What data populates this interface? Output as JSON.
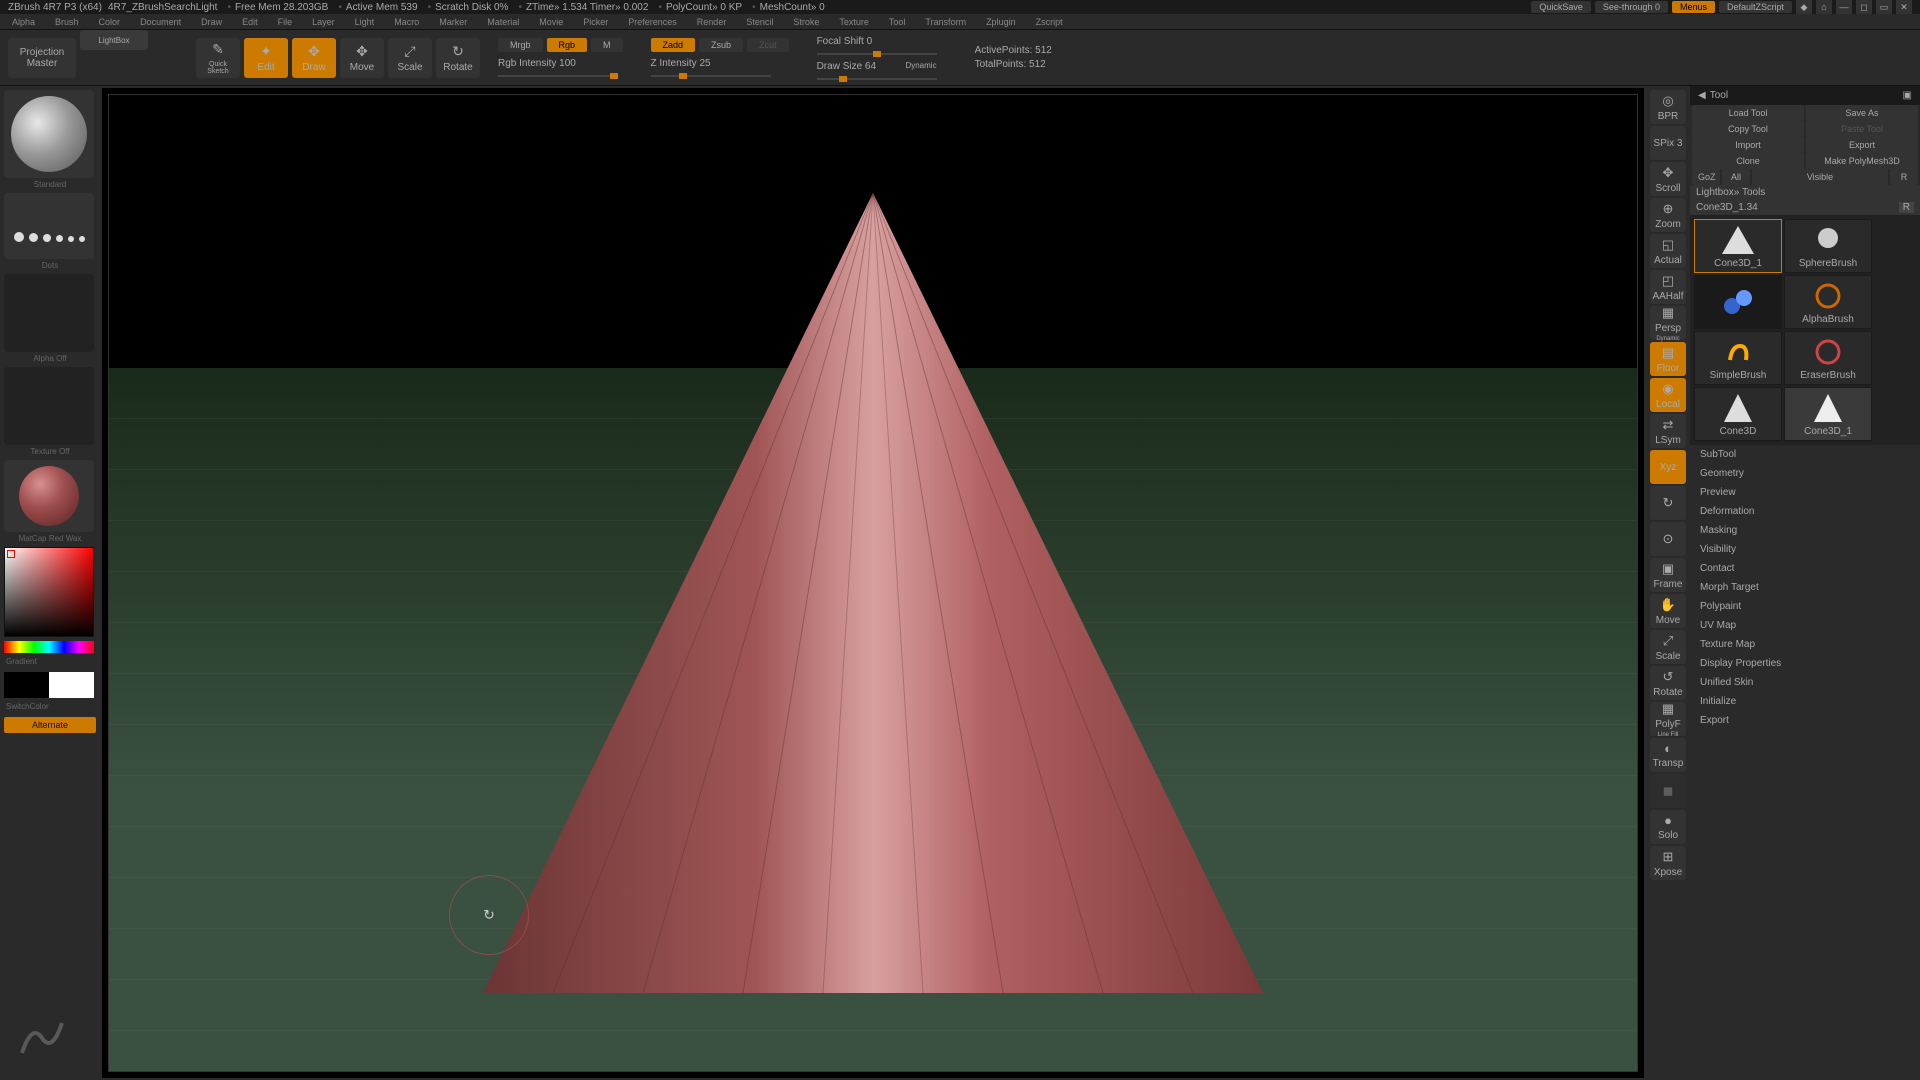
{
  "status": {
    "app": "ZBrush 4R7 P3 (x64)",
    "doc": "4R7_ZBrushSearchLight",
    "mem": "Free Mem 28.203GB",
    "active_mem": "Active Mem 539",
    "scratch": "Scratch Disk 0%",
    "ztime": "ZTime» 1.534 Timer» 0.002",
    "poly": "PolyCount» 0 KP",
    "mesh": "MeshCount» 0",
    "quicksave": "QuickSave",
    "seethrough": "See-through   0",
    "menus": "Menus",
    "script": "DefaultZScript"
  },
  "menus": [
    "Alpha",
    "Brush",
    "Color",
    "Document",
    "Draw",
    "Edit",
    "File",
    "Layer",
    "Light",
    "Macro",
    "Marker",
    "Material",
    "Movie",
    "Picker",
    "Preferences",
    "Render",
    "Stencil",
    "Stroke",
    "Texture",
    "Tool",
    "Transform",
    "Zplugin",
    "Zscript"
  ],
  "toolbar": {
    "projection": "Projection\nMaster",
    "lightbox": "LightBox",
    "quicksketch": "Quick\nSketch",
    "edit": "Edit",
    "draw": "Draw",
    "move": "Move",
    "scale": "Scale",
    "rotate": "Rotate",
    "mrgb": "Mrgb",
    "rgb": "Rgb",
    "m": "M",
    "rgb_intensity": "Rgb Intensity 100",
    "zadd": "Zadd",
    "zsub": "Zsub",
    "zcut": "Zcut",
    "z_intensity": "Z Intensity 25",
    "focal": "Focal Shift 0",
    "draw_size": "Draw Size 64",
    "dynamic": "Dynamic",
    "active_points": "ActivePoints: 512",
    "total_points": "TotalPoints: 512"
  },
  "left": {
    "brush": "Standard",
    "dots": "Dots",
    "alpha": "Alpha Off",
    "texture": "Texture Off",
    "matcap": "MatCap Red Wax",
    "gradient": "Gradient",
    "switchcolor": "SwitchColor",
    "alternate": "Alternate"
  },
  "rightstrip": [
    {
      "label": "BPR",
      "ic": "◎"
    },
    {
      "label": "SPix 3",
      "ic": ""
    },
    {
      "label": "Scroll",
      "ic": "✥"
    },
    {
      "label": "Zoom",
      "ic": "⊕"
    },
    {
      "label": "Actual",
      "ic": "◱"
    },
    {
      "label": "AAHalf",
      "ic": "◰"
    },
    {
      "label": "Persp",
      "ic": "▦",
      "sub": "Dynamic"
    },
    {
      "label": "Floor",
      "ic": "▤",
      "active": true
    },
    {
      "label": "Local",
      "ic": "◉",
      "active": true
    },
    {
      "label": "LSym",
      "ic": "⇄"
    },
    {
      "label": "Xyz",
      "ic": "",
      "active": true
    },
    {
      "label": "",
      "ic": "↻"
    },
    {
      "label": "",
      "ic": "⊙"
    },
    {
      "label": "Frame",
      "ic": "▣"
    },
    {
      "label": "Move",
      "ic": "✋"
    },
    {
      "label": "Scale",
      "ic": "⤢"
    },
    {
      "label": "Rotate",
      "ic": "↺"
    },
    {
      "label": "PolyF",
      "ic": "▦",
      "sub": "Line Fill"
    },
    {
      "label": "Transp",
      "ic": "◐"
    },
    {
      "label": "",
      "ic": "◼",
      "dim": true
    },
    {
      "label": "Solo",
      "ic": "●"
    },
    {
      "label": "Xpose",
      "ic": "⊞"
    }
  ],
  "rightpanel": {
    "title": "Tool",
    "row1": [
      "Load Tool",
      "Save As"
    ],
    "row2": [
      "Copy Tool",
      "Paste Tool"
    ],
    "row3": [
      "Import",
      "Export"
    ],
    "row4": [
      "Clone",
      "Make PolyMesh3D"
    ],
    "row5": [
      "GoZ",
      "All",
      "Visible",
      "R"
    ],
    "lightbox": "Lightbox» Tools",
    "current": "Cone3D_1.34",
    "tools": [
      {
        "name": "Cone3D_1",
        "svg": "cone"
      },
      {
        "name": "SphereBrush",
        "svg": "sphere"
      },
      {
        "name": "",
        "svg": ""
      },
      {
        "name": "AlphaBrush",
        "svg": "alpha"
      },
      {
        "name": "SimpleBrush",
        "svg": "simple"
      },
      {
        "name": "EraserBrush",
        "svg": "eraser"
      },
      {
        "name": "Cone3D",
        "svg": "cone2"
      },
      {
        "name": "Cone3D_1",
        "svg": "cone3"
      }
    ],
    "sections": [
      "SubTool",
      "Geometry",
      "Preview",
      "Deformation",
      "Masking",
      "Visibility",
      "Contact",
      "Morph Target",
      "Polypaint",
      "UV Map",
      "Texture Map",
      "Display Properties",
      "Unified Skin",
      "Initialize",
      "Export"
    ]
  }
}
